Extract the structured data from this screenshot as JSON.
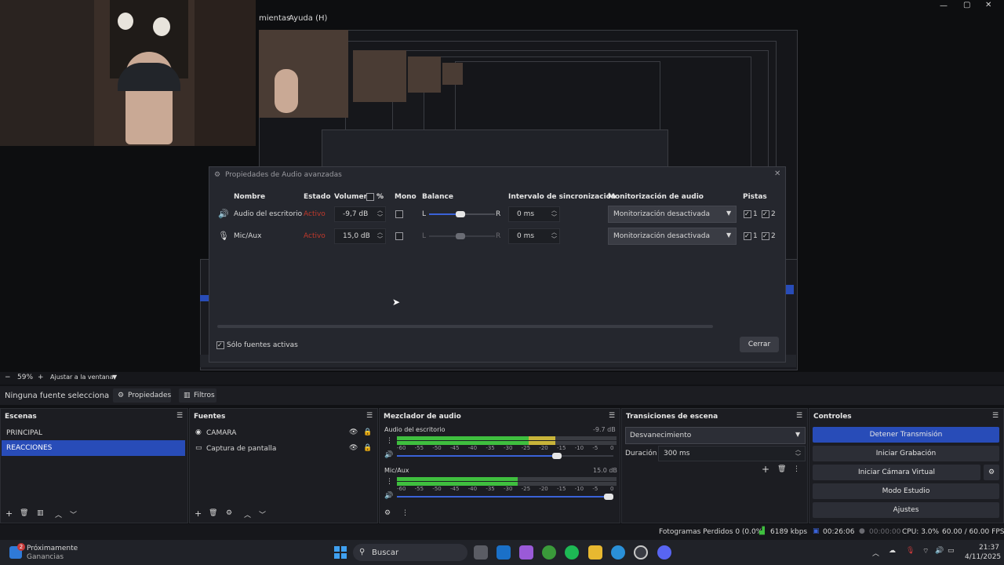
{
  "menu": {
    "item_partial": "mientas",
    "help": "Ayuda (H)"
  },
  "window_controls": {
    "minimize": "—",
    "maximize": "▢",
    "close": "✕"
  },
  "zoom": {
    "minus": "−",
    "value": "59%",
    "plus": "+",
    "fit": "Ajustar a la ventana"
  },
  "dialog": {
    "title": "Propiedades de Audio avanzadas",
    "headers": {
      "name": "Nombre",
      "state": "Estado",
      "volume": "Volumen",
      "percent": "%",
      "mono": "Mono",
      "balance": "Balance",
      "sync": "Intervalo de sincronización",
      "monitor": "Monitorización de audio",
      "tracks": "Pistas"
    },
    "rows": [
      {
        "icon": "speaker-icon",
        "name": "Audio del escritorio",
        "state": "Activo",
        "volume": "-9,7 dB",
        "mono": false,
        "bal_l": "L",
        "bal_r": "R",
        "balance": 0.5,
        "sync": "0 ms",
        "monitor": "Monitorización desactivada",
        "track1": "1",
        "track2": "2"
      },
      {
        "icon": "microphone-icon",
        "name": "Mic/Aux",
        "state": "Activo",
        "volume": "15,0 dB",
        "mono": false,
        "bal_l": "L",
        "bal_r": "R",
        "balance": 0.5,
        "sync": "0 ms",
        "monitor": "Monitorización desactivada",
        "track1": "1",
        "track2": "2"
      }
    ],
    "active_only": "Sólo fuentes activas",
    "close_btn": "Cerrar"
  },
  "source_bar": {
    "none": "Ninguna fuente selecciona",
    "props": "Propiedades",
    "filters": "Filtros"
  },
  "scenes": {
    "title": "Escenas",
    "items": [
      "PRINCIPAL",
      "REACCIONES"
    ],
    "selected": 1
  },
  "sources": {
    "title": "Fuentes",
    "items": [
      "CAMARA",
      "Captura de pantalla"
    ]
  },
  "mixer": {
    "title": "Mezclador de audio",
    "channels": [
      {
        "name": "Audio del escritorio",
        "db": "-9.7 dB",
        "level": 0.72,
        "volume": 0.74
      },
      {
        "name": "Mic/Aux",
        "db": "15.0 dB",
        "level": 0.55,
        "volume": 0.98
      }
    ],
    "ticks": [
      "-60",
      "-55",
      "-50",
      "-45",
      "-40",
      "-35",
      "-30",
      "-25",
      "-20",
      "-15",
      "-10",
      "-5",
      "0"
    ]
  },
  "transitions": {
    "title": "Transiciones de escena",
    "selected": "Desvanecimiento",
    "duration_label": "Duración",
    "duration": "300 ms"
  },
  "controls": {
    "title": "Controles",
    "stop_stream": "Detener Transmisión",
    "start_rec": "Iniciar Grabación",
    "virtual_cam": "Iniciar Cámara Virtual",
    "studio": "Modo Estudio",
    "settings": "Ajustes"
  },
  "status": {
    "dropped": "Fotogramas Perdidos 0 (0.0%)",
    "bitrate": "6189 kbps",
    "stream_time": "00:26:06",
    "rec_time": "00:00:00",
    "cpu": "CPU: 3.0%",
    "fps": "60.00 / 60.00 FPS"
  },
  "taskbar": {
    "widget_title": "Próximamente",
    "widget_sub": "Ganancias",
    "badge": "2",
    "search": "Buscar",
    "time": "21:37",
    "date": "4/11/2025"
  },
  "colors": {
    "accent": "#284cb8",
    "active_state": "#c0392b",
    "meter_green": "#3fbf3f",
    "meter_yellow": "#c8b43a",
    "meter_red": "#c83a3a"
  }
}
